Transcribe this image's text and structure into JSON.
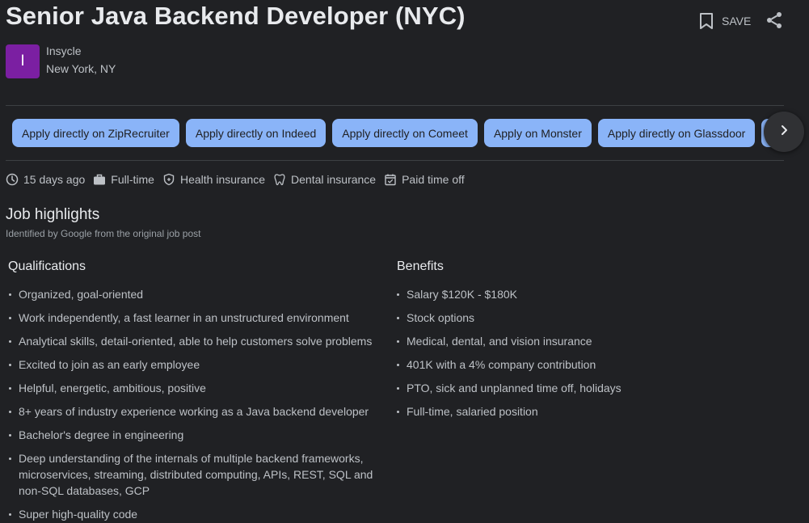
{
  "job": {
    "title": "Senior Java Backend Developer (NYC)",
    "save_label": "SAVE",
    "company": {
      "logo_letter": "I",
      "name": "Insycle",
      "location": "New York, NY"
    }
  },
  "apply_options": [
    {
      "label": "Apply directly on ZipRecruiter"
    },
    {
      "label": "Apply directly on Indeed"
    },
    {
      "label": "Apply directly on Comeet"
    },
    {
      "label": "Apply on Monster"
    },
    {
      "label": "Apply directly on Glassdoor"
    }
  ],
  "meta": [
    {
      "icon": "clock-icon",
      "label": "15 days ago"
    },
    {
      "icon": "briefcase-icon",
      "label": "Full-time"
    },
    {
      "icon": "shield-icon",
      "label": "Health insurance"
    },
    {
      "icon": "tooth-icon",
      "label": "Dental insurance"
    },
    {
      "icon": "calendar-check-icon",
      "label": "Paid time off"
    }
  ],
  "highlights": {
    "title": "Job highlights",
    "subtitle": "Identified by Google from the original job post",
    "qualifications": {
      "heading": "Qualifications",
      "items": [
        "Organized, goal-oriented",
        "Work independently, a fast learner in an unstructured environment",
        "Analytical skills, detail-oriented, able to help customers solve problems",
        "Excited to join as an early employee",
        "Helpful, energetic, ambitious, positive",
        "8+ years of industry experience working as a Java backend developer",
        "Bachelor's degree in engineering",
        "Deep understanding of the internals of multiple backend frameworks, microservices, streaming, distributed computing, APIs, REST, SQL and non-SQL databases, GCP",
        "Super high-quality code"
      ]
    },
    "benefits": {
      "heading": "Benefits",
      "items": [
        "Salary $120K - $180K",
        "Stock options",
        "Medical, dental, and vision insurance",
        "401K with a 4% company contribution",
        "PTO, sick and unplanned time off, holidays",
        "Full-time, salaried position"
      ]
    }
  },
  "colors": {
    "background": "#202124",
    "apply_button": "#8ab4f8",
    "logo": "#7b1fa2"
  }
}
